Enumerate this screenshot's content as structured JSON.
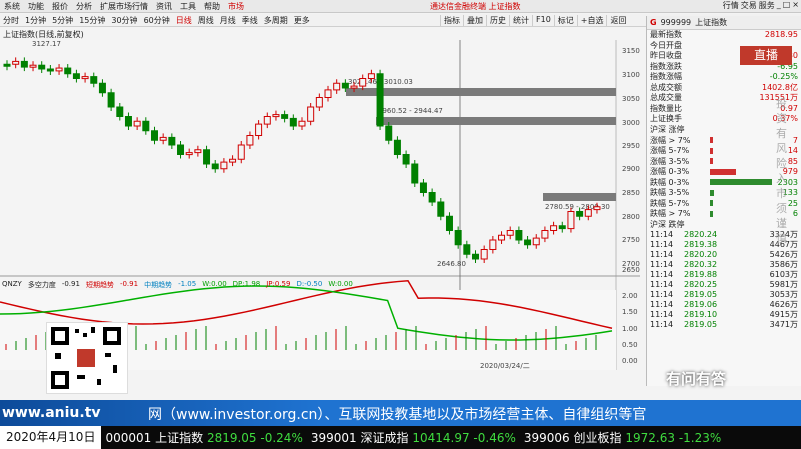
{
  "menubar": {
    "items": [
      "系统",
      "功能",
      "报价",
      "分析",
      "扩展市场行情",
      "资讯",
      "工具",
      "帮助",
      "市场"
    ],
    "center": "通达信金融终端  上证指数",
    "win": [
      "行情",
      "交易",
      "服务",
      "_",
      "□",
      "×"
    ]
  },
  "toolbar": {
    "periods": [
      "分时",
      "1分钟",
      "5分钟",
      "15分钟",
      "30分钟",
      "60分钟",
      "日线",
      "周线",
      "月线",
      "季线",
      "多周期",
      "更多"
    ],
    "tools": [
      "指标",
      "叠加",
      "历史",
      "统计",
      "F10",
      "标记",
      "+自选",
      "返回"
    ]
  },
  "chart_header": {
    "title": "上证指数(日线,前复权)",
    "peak_label": "3127.17",
    "low_label": "2646.80",
    "zone1": "3029.46 - 3010.03",
    "zone2": "2960.52 - 2944.47",
    "zone3": "2780.59 - 2800.30"
  },
  "price_axis": [
    "3150",
    "3100",
    "3050",
    "3000",
    "2950",
    "2900",
    "2850",
    "2800",
    "2750",
    "2700",
    "2650"
  ],
  "indicator": {
    "name": "QNZY",
    "label1": "多空力度",
    "v1": "-0.91",
    "label2": "短期趋势",
    "v2": "-0.91",
    "label3": "中期趋势",
    "v3": "-1.05",
    "label4": "W:0.00",
    "dp": "DP:1.98",
    "jp": "JP:0.59",
    "d": "D:-0.50",
    "w": "W:0.00",
    "axis": [
      "2.00",
      "1.50",
      "1.00",
      "0.50",
      "0.00"
    ],
    "date_marker": "2020/03/24/二"
  },
  "right_panel": {
    "code": "999999",
    "name": "上证指数",
    "fields": [
      {
        "k": "最新指数",
        "v": "2818.95"
      },
      {
        "k": "今日开盘",
        "v": ""
      },
      {
        "k": "昨日收盘",
        "v": "2825.80"
      },
      {
        "k": "指数涨跌",
        "v": "-6.95"
      },
      {
        "k": "指数涨幅",
        "v": "-0.25%"
      },
      {
        "k": "总成交额",
        "v": "1402.8亿"
      },
      {
        "k": "总成交量",
        "v": "131551万"
      },
      {
        "k": "指数量比",
        "v": "0.97"
      },
      {
        "k": "上证换手",
        "v": "0.37%"
      }
    ],
    "rise_header": "沪深 涨停",
    "rise": [
      {
        "k": "涨幅 > 7%",
        "v": "7"
      },
      {
        "k": "涨幅 5-7%",
        "v": "14"
      },
      {
        "k": "涨幅 3-5%",
        "v": "85"
      },
      {
        "k": "涨幅 0-3%",
        "v": "979"
      }
    ],
    "fall": [
      {
        "k": "跌幅 0-3%",
        "v": "2303"
      },
      {
        "k": "跌幅 3-5%",
        "v": "133"
      },
      {
        "k": "跌幅 5-7%",
        "v": "25"
      },
      {
        "k": "跌幅 > 7%",
        "v": "6"
      }
    ],
    "fall_footer": "沪深 跌停",
    "ticks": [
      {
        "t": "11:14",
        "p": "2820.24",
        "q": "3324万"
      },
      {
        "t": "11:14",
        "p": "2819.38",
        "q": "4467万"
      },
      {
        "t": "11:14",
        "p": "2820.20",
        "q": "5426万"
      },
      {
        "t": "11:14",
        "p": "2820.32",
        "q": "3586万"
      },
      {
        "t": "11:14",
        "p": "2819.88",
        "q": "6103万"
      },
      {
        "t": "11:14",
        "p": "2820.25",
        "q": "5981万"
      },
      {
        "t": "11:14",
        "p": "2819.05",
        "q": "3053万"
      },
      {
        "t": "11:14",
        "p": "2819.06",
        "q": "4626万"
      },
      {
        "t": "11:14",
        "p": "2819.10",
        "q": "4915万"
      },
      {
        "t": "11:14",
        "p": "2819.05",
        "q": "3471万"
      }
    ]
  },
  "live": "直播",
  "watermark": "投资有风险入市须谨慎",
  "yiwen": "有问有答",
  "brand": {
    "url": "www.aniu.tv",
    "scroll": "网（www.investor.org.cn）、互联网投教基地以及市场经营主体、自律组织等官"
  },
  "ticker": {
    "date": "2020年4月10日",
    "items": [
      {
        "code": "000001",
        "name": "上证指数",
        "value": "2819.05",
        "chg": "-0.24%"
      },
      {
        "code": "399001",
        "name": "深证成指",
        "value": "10414.97",
        "chg": "-0.46%"
      },
      {
        "code": "399006",
        "name": "创业板指",
        "value": "1972.63",
        "chg": "-1.23%"
      }
    ]
  },
  "colors": {
    "up": "#d00000",
    "down": "#008000",
    "brand": "#1f73d1"
  }
}
